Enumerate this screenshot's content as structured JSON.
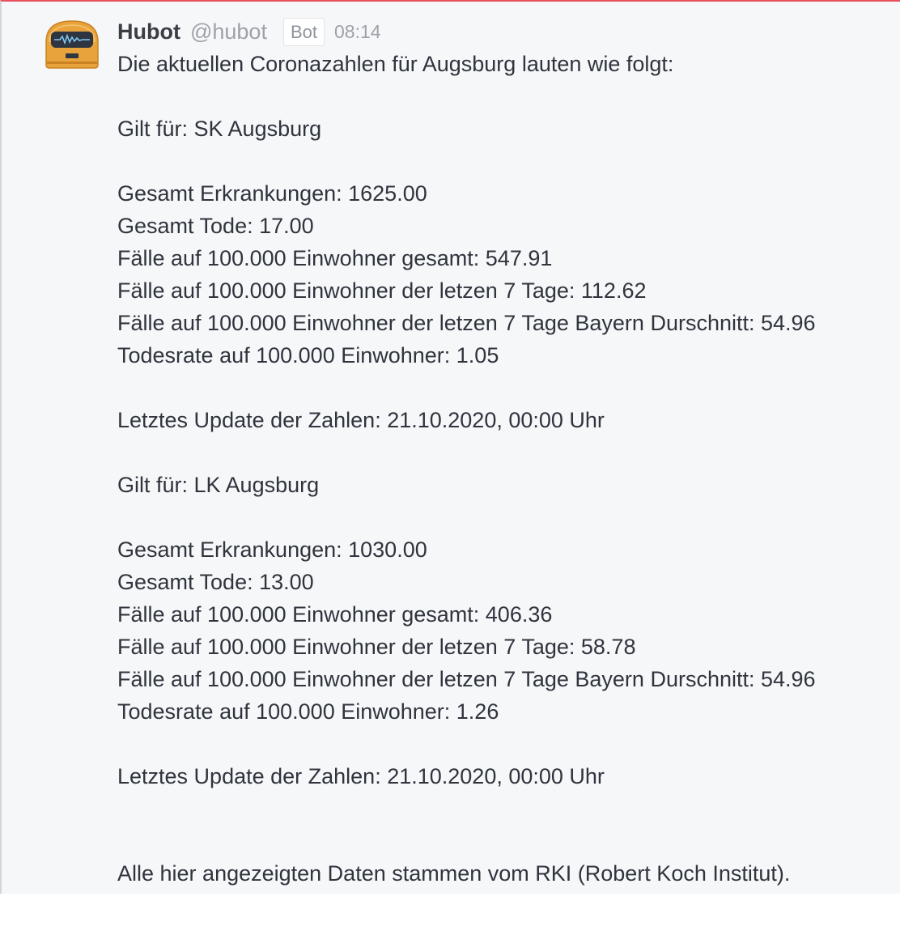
{
  "message": {
    "sender": "Hubot",
    "handle": "@hubot",
    "badge": "Bot",
    "time": "08:14",
    "intro": "Die aktuellen Coronazahlen für Augsburg lauten wie folgt:",
    "regions": [
      {
        "title": "Gilt für: SK Augsburg",
        "total_cases": "Gesamt Erkrankungen: 1625.00",
        "total_deaths": "Gesamt Tode: 17.00",
        "cases_per_100k": "Fälle auf 100.000 Einwohner gesamt: 547.91",
        "cases_7d": "Fälle auf 100.000 Einwohner der letzen 7 Tage: 112.62",
        "cases_7d_bavaria": "Fälle auf 100.000 Einwohner der letzen 7 Tage Bayern Durschnitt: 54.96",
        "death_rate": "Todesrate auf 100.000 Einwohner: 1.05",
        "last_update": "Letztes Update der Zahlen: 21.10.2020, 00:00 Uhr"
      },
      {
        "title": "Gilt für: LK Augsburg",
        "total_cases": "Gesamt Erkrankungen: 1030.00",
        "total_deaths": "Gesamt Tode: 13.00",
        "cases_per_100k": "Fälle auf 100.000 Einwohner gesamt: 406.36",
        "cases_7d": "Fälle auf 100.000 Einwohner der letzen 7 Tage: 58.78",
        "cases_7d_bavaria": "Fälle auf 100.000 Einwohner der letzen 7 Tage Bayern Durschnitt: 54.96",
        "death_rate": "Todesrate auf 100.000 Einwohner: 1.26",
        "last_update": "Letztes Update der Zahlen: 21.10.2020, 00:00 Uhr"
      }
    ],
    "footer": "Alle hier angezeigten Daten stammen vom RKI (Robert Koch Institut)."
  },
  "colors": {
    "panel_background": "#f6f7f9",
    "top_accent": "#e8505f",
    "avatar_body": "#e8a33c",
    "avatar_screen": "#2e3440",
    "avatar_wave": "#7ec8f0"
  },
  "icons": {
    "avatar": "hubot-robot-avatar"
  }
}
